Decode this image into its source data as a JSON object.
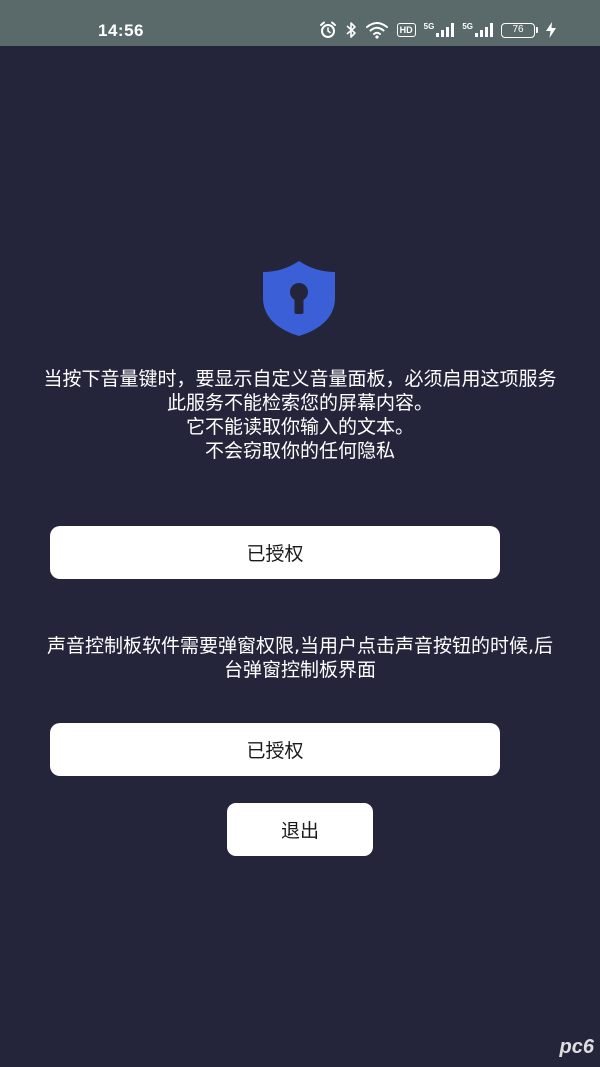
{
  "status_bar": {
    "time": "14:56",
    "signal_1_label": "5G",
    "signal_2_label": "5G",
    "hd_label": "HD",
    "battery": "76",
    "icons": [
      "alarm-icon",
      "bluetooth-icon",
      "wifi-icon",
      "hd-icon",
      "signal-icon",
      "signal-icon",
      "battery-icon",
      "charging-icon"
    ]
  },
  "shield": {
    "icon": "shield-keyhole-icon",
    "color": "#3b5fd6"
  },
  "accessibility": {
    "lines": [
      "当按下音量键时，要显示自定义音量面板，必须启用这项服务",
      "此服务不能检索您的屏幕内容。",
      "它不能读取你输入的文本。",
      "不会窃取你的任何隐私"
    ],
    "button_label": "已授权"
  },
  "overlay": {
    "text": "声音控制板软件需要弹窗权限,当用户点击声音按钮的时候,后台弹窗控制板界面",
    "button_label": "已授权"
  },
  "exit_button_label": "退出",
  "colors": {
    "background": "#24253b",
    "status_bar": "#5a6a6a",
    "button": "#ffffff"
  }
}
